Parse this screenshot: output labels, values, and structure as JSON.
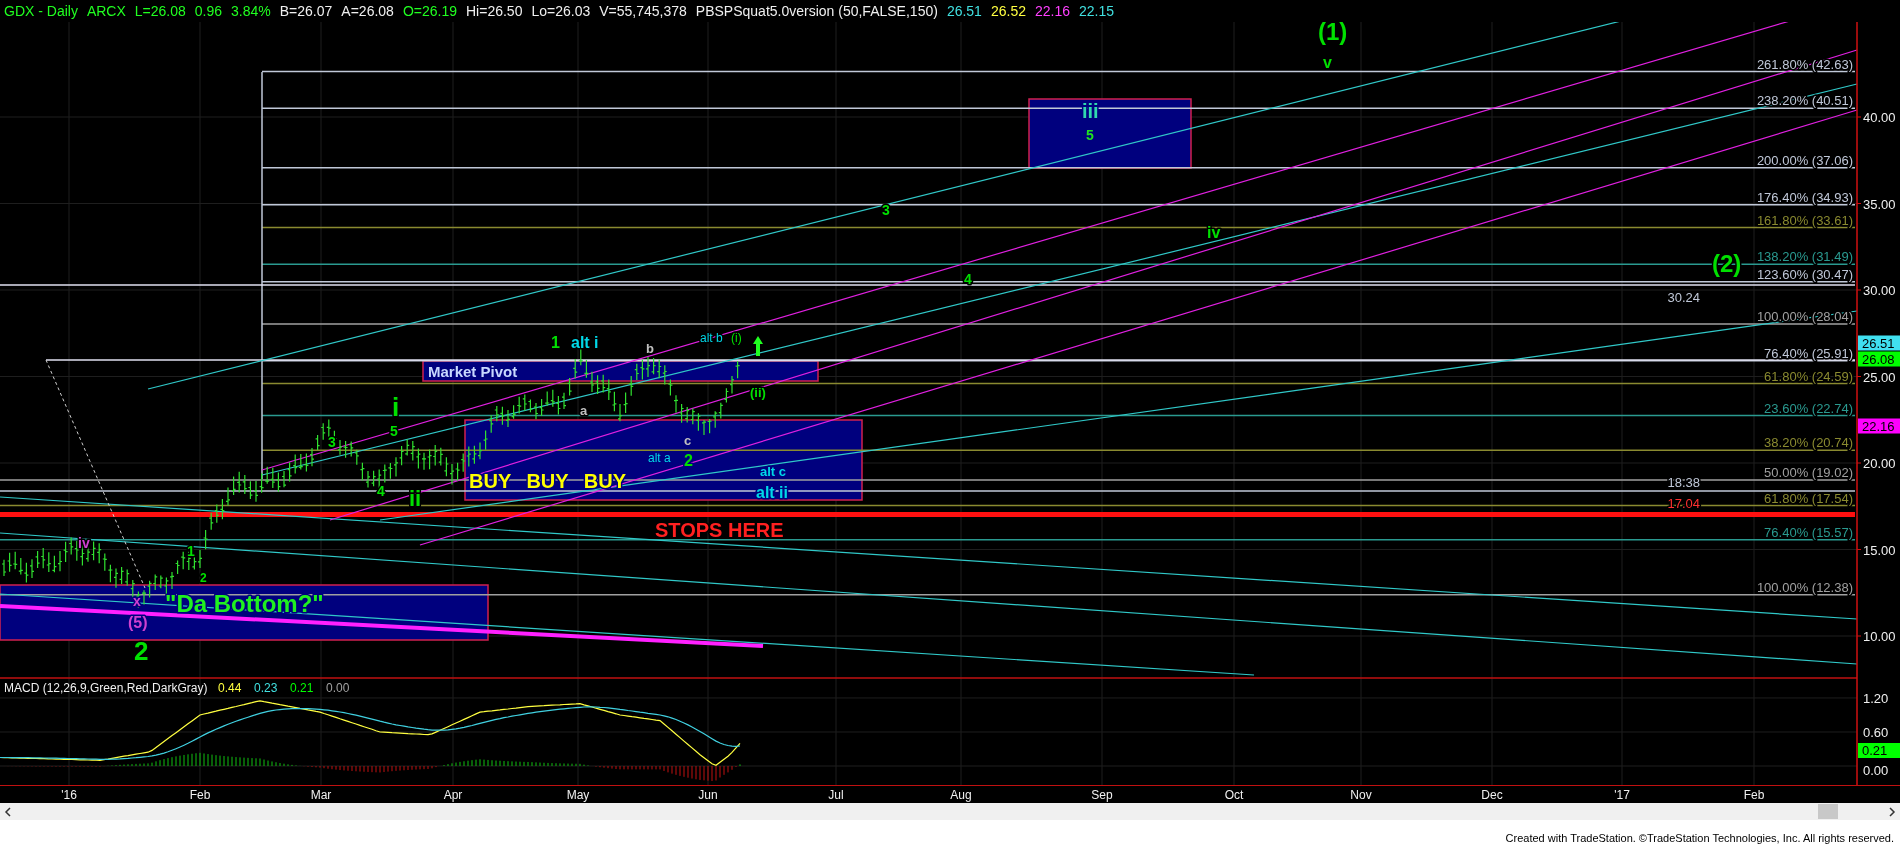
{
  "header": {
    "symbol": "GDX - Daily",
    "exchange": "ARCX",
    "last": "L=26.08",
    "change": "0.96",
    "change_percent": "3.84%",
    "bid": "B=26.07",
    "ask": "A=26.08",
    "open": "O=26.19",
    "high": "Hi=26.50",
    "low": "Lo=26.03",
    "volume": "V=55,745,378",
    "indicator": "PBSPSquat5.0version (50,FALSE,150)",
    "indicator_values": [
      {
        "text": "26.51",
        "color": "#40e0e0"
      },
      {
        "text": "26.52",
        "color": "#ffff40"
      },
      {
        "text": "22.16",
        "color": "#ff40ff"
      },
      {
        "text": "22.15",
        "color": "#40e0e0"
      }
    ]
  },
  "price_axis": {
    "ticks": [
      "40.00",
      "35.00",
      "30.00",
      "25.00",
      "20.00",
      "15.00",
      "10.00"
    ],
    "markers": [
      {
        "text": "26.51",
        "color": "#40e0f0"
      },
      {
        "text": "26.08",
        "color": "#00ff00"
      },
      {
        "text": "22.16",
        "color": "#ff00ff"
      }
    ]
  },
  "fib_levels": [
    {
      "label": "261.80% (42.63)",
      "color": "#c0c8d8"
    },
    {
      "label": "238.20% (40.51)",
      "color": "#c0c8d8"
    },
    {
      "label": "200.00% (37.06)",
      "color": "#c0c8d8"
    },
    {
      "label": "176.40% (34.93)",
      "color": "#c0c8d8"
    },
    {
      "label": "161.80% (33.61)",
      "color": "#8a8a30"
    },
    {
      "label": "138.20% (31.49)",
      "color": "#2a9a90"
    },
    {
      "label": "123.60% (30.47)",
      "color": "#c0c8d8"
    },
    {
      "label": "100.00% (28.04)",
      "color": "#a0a0a0"
    },
    {
      "label": "76.40% (25.91)",
      "color": "#c0c8d8"
    },
    {
      "label": "61.80% (24.59)",
      "color": "#8a8a30"
    },
    {
      "label": "23.60% (22.74)",
      "color": "#2a9a90"
    },
    {
      "label": "38.20% (20.74)",
      "color": "#8a8a30"
    },
    {
      "label": "50.00% (19.02)",
      "color": "#a0a0a0"
    },
    {
      "label": "61.80% (17.54)",
      "color": "#8a8a30"
    },
    {
      "label": "76.40% (15.57)",
      "color": "#2a9a90"
    },
    {
      "label": "100.00% (12.38)",
      "color": "#a0a0a0"
    }
  ],
  "line_values": [
    {
      "text": "30.24",
      "color": "#c0c8d8"
    },
    {
      "text": "18.38",
      "color": "#c0c8d8"
    },
    {
      "text": "17.04",
      "color": "#ff3030"
    }
  ],
  "zones": [
    {
      "labels": [
        "iii",
        "5"
      ]
    },
    {
      "labels": [
        "Market Pivot"
      ]
    },
    {
      "labels": [
        "BUY BUY BUY"
      ]
    },
    {
      "labels": [
        "\"Da Bottom?\""
      ]
    }
  ],
  "stops": {
    "label": "STOPS HERE"
  },
  "wave_labels": [
    {
      "text": "(1)",
      "color": "#00e000"
    },
    {
      "text": "v",
      "color": "#00e000"
    },
    {
      "text": "3",
      "color": "#00e000"
    },
    {
      "text": "iv",
      "color": "#00e000"
    },
    {
      "text": "(2)",
      "color": "#00e000"
    },
    {
      "text": "4",
      "color": "#00e000"
    },
    {
      "text": "1",
      "color": "#00e000"
    },
    {
      "text": "alt i",
      "color": "#00d8e8"
    },
    {
      "text": "b",
      "color": "#c0c0c0"
    },
    {
      "text": "alt b",
      "color": "#00d8e8"
    },
    {
      "text": "(i)",
      "color": "#00e000"
    },
    {
      "text": "(ii)",
      "color": "#00e000"
    },
    {
      "text": "a",
      "color": "#c0c0c0"
    },
    {
      "text": "c",
      "color": "#c0c0c0"
    },
    {
      "text": "alt a",
      "color": "#00d8e8"
    },
    {
      "text": "2",
      "color": "#00e000"
    },
    {
      "text": "alt c",
      "color": "#00d8e8"
    },
    {
      "text": "alt ii",
      "color": "#00d8e8"
    },
    {
      "text": "i",
      "color": "#00e000"
    },
    {
      "text": "5",
      "color": "#00e000"
    },
    {
      "text": "3",
      "color": "#00e000"
    },
    {
      "text": "4",
      "color": "#00e000"
    },
    {
      "text": "ii",
      "color": "#00e000"
    },
    {
      "text": "iv",
      "color": "#d040d0"
    },
    {
      "text": "1",
      "color": "#00e000"
    },
    {
      "text": "2",
      "color": "#00e000"
    },
    {
      "text": "x",
      "color": "#d040d0"
    },
    {
      "text": "(5)",
      "color": "#d040d0"
    },
    {
      "text": "2",
      "color": "#00e000"
    }
  ],
  "macd": {
    "title": "MACD (12,26,9,Green,Red,DarkGray)",
    "values": [
      {
        "text": "0.44",
        "color": "#ffff40"
      },
      {
        "text": "0.23",
        "color": "#40e0e0"
      },
      {
        "text": "0.21",
        "color": "#00ff00"
      },
      {
        "text": "0.00",
        "color": "#a0a0a0"
      }
    ],
    "ticks": [
      "1.20",
      "0.60",
      "0.00"
    ],
    "marker": {
      "text": "0.21",
      "color": "#00ff00"
    }
  },
  "date_axis": [
    "'16",
    "Feb",
    "Mar",
    "Apr",
    "May",
    "Jun",
    "Jul",
    "Aug",
    "Sep",
    "Oct",
    "Nov",
    "Dec",
    "'17",
    "Feb"
  ],
  "footer": "Created with TradeStation. ©TradeStation Technologies, Inc. All rights reserved."
}
